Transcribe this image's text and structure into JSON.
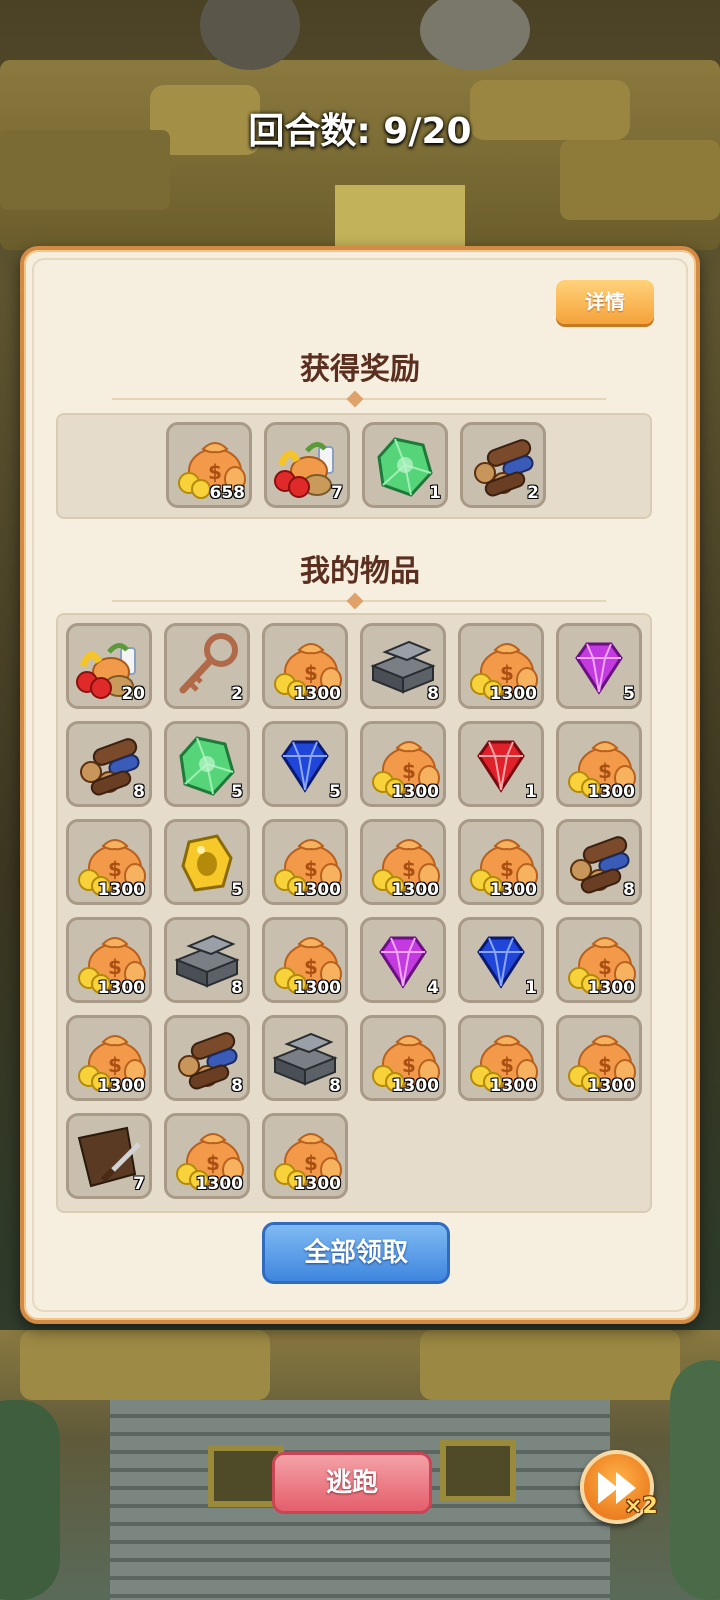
{
  "header": {
    "round_counter": "回合数: 9/20"
  },
  "panel": {
    "details_label": "详情",
    "rewards_title": "获得奖励",
    "items_title": "我的物品",
    "claim_all_label": "全部领取"
  },
  "rewards": [
    {
      "icon": "money-bag-icon",
      "qty": "658"
    },
    {
      "icon": "food-icon",
      "qty": "7"
    },
    {
      "icon": "green-crystal-icon",
      "qty": "1"
    },
    {
      "icon": "wood-logs-icon",
      "qty": "2"
    }
  ],
  "items": [
    {
      "icon": "food-icon",
      "qty": "20"
    },
    {
      "icon": "key-icon",
      "qty": "2"
    },
    {
      "icon": "money-bag-icon",
      "qty": "1300"
    },
    {
      "icon": "iron-ingot-icon",
      "qty": "8"
    },
    {
      "icon": "money-bag-icon",
      "qty": "1300"
    },
    {
      "icon": "purple-gem-icon",
      "qty": "5"
    },
    {
      "icon": "wood-logs-icon",
      "qty": "8"
    },
    {
      "icon": "green-crystal-icon",
      "qty": "5"
    },
    {
      "icon": "blue-gem-icon",
      "qty": "5"
    },
    {
      "icon": "money-bag-icon",
      "qty": "1300"
    },
    {
      "icon": "red-gem-icon",
      "qty": "1"
    },
    {
      "icon": "money-bag-icon",
      "qty": "1300"
    },
    {
      "icon": "money-bag-icon",
      "qty": "1300"
    },
    {
      "icon": "gold-ore-icon",
      "qty": "5"
    },
    {
      "icon": "money-bag-icon",
      "qty": "1300"
    },
    {
      "icon": "money-bag-icon",
      "qty": "1300"
    },
    {
      "icon": "money-bag-icon",
      "qty": "1300"
    },
    {
      "icon": "wood-logs-icon",
      "qty": "8"
    },
    {
      "icon": "money-bag-icon",
      "qty": "1300"
    },
    {
      "icon": "iron-ingot-icon",
      "qty": "8"
    },
    {
      "icon": "money-bag-icon",
      "qty": "1300"
    },
    {
      "icon": "purple-gem-icon",
      "qty": "4"
    },
    {
      "icon": "blue-gem-icon",
      "qty": "1"
    },
    {
      "icon": "money-bag-icon",
      "qty": "1300"
    },
    {
      "icon": "money-bag-icon",
      "qty": "1300"
    },
    {
      "icon": "wood-logs-icon",
      "qty": "8"
    },
    {
      "icon": "iron-ingot-icon",
      "qty": "8"
    },
    {
      "icon": "money-bag-icon",
      "qty": "1300"
    },
    {
      "icon": "money-bag-icon",
      "qty": "1300"
    },
    {
      "icon": "money-bag-icon",
      "qty": "1300"
    },
    {
      "icon": "leather-knife-icon",
      "qty": "7"
    },
    {
      "icon": "money-bag-icon",
      "qty": "1300"
    },
    {
      "icon": "money-bag-icon",
      "qty": "1300"
    }
  ],
  "footer": {
    "escape_label": "逃跑",
    "speed_label": "×2"
  },
  "colors": {
    "panel_border": "#d28a45",
    "details_button": "#f5a23a",
    "claim_button": "#3f86de",
    "escape_button": "#e45f6c",
    "speed_button": "#e56a12"
  }
}
